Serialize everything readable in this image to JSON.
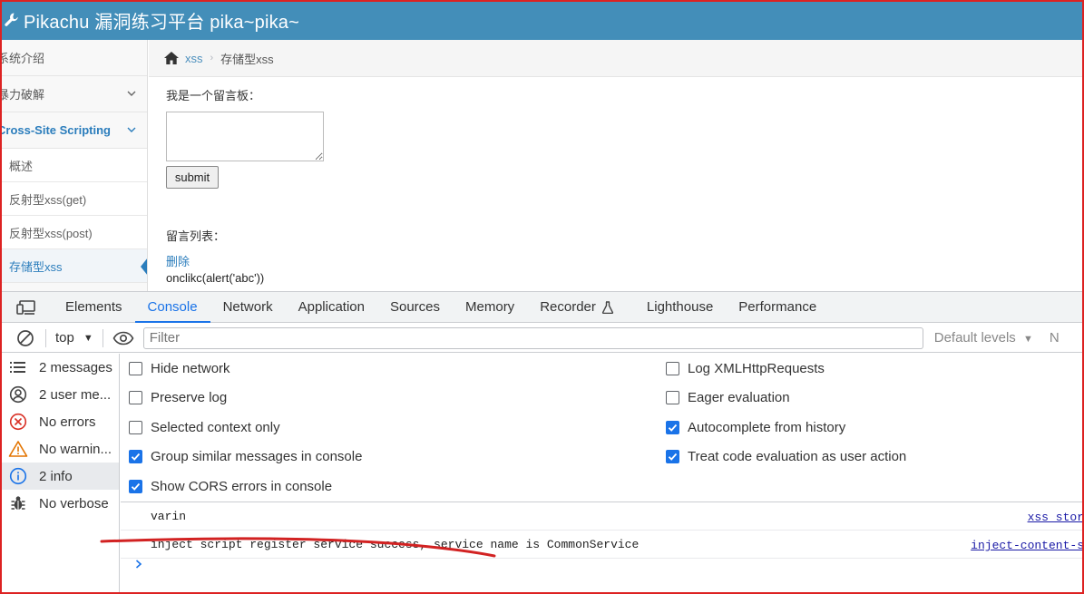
{
  "app": {
    "title": "Pikachu 漏洞练习平台 pika~pika~"
  },
  "sidebar": {
    "items": [
      {
        "label": "系统介绍"
      },
      {
        "label": "暴力破解"
      },
      {
        "label": "Cross-Site Scripting"
      }
    ],
    "subitems": [
      {
        "label": "概述"
      },
      {
        "label": "反射型xss(get)"
      },
      {
        "label": "反射型xss(post)"
      },
      {
        "label": "存储型xss"
      }
    ]
  },
  "breadcrumb": {
    "parent": "xss",
    "current": "存储型xss"
  },
  "content": {
    "board_label": "我是一个留言板：",
    "message_value": "",
    "submit_label": "submit",
    "list_label": "留言列表：",
    "delete_label": "删除",
    "message_text": "onclikc(alert('abc'))"
  },
  "devtools": {
    "tabs": [
      "Elements",
      "Console",
      "Network",
      "Application",
      "Sources",
      "Memory",
      "Recorder",
      "Lighthouse",
      "Performance"
    ],
    "active_tab": "Console",
    "toolbar": {
      "context": "top",
      "filter_placeholder": "Filter",
      "levels": "Default levels",
      "more": "N"
    },
    "sidebar": [
      {
        "label": "2 messages",
        "icon": "list-icon"
      },
      {
        "label": "2 user me...",
        "icon": "user-icon"
      },
      {
        "label": "No errors",
        "icon": "error-icon"
      },
      {
        "label": "No warnin...",
        "icon": "warning-icon"
      },
      {
        "label": "2 info",
        "icon": "info-icon"
      },
      {
        "label": "No verbose",
        "icon": "bug-icon"
      }
    ],
    "settings": [
      {
        "label": "Hide network",
        "checked": false
      },
      {
        "label": "Preserve log",
        "checked": false
      },
      {
        "label": "Selected context only",
        "checked": false
      },
      {
        "label": "Group similar messages in console",
        "checked": true
      },
      {
        "label": "Show CORS errors in console",
        "checked": true
      },
      {
        "label": "Log XMLHttpRequests",
        "checked": false
      },
      {
        "label": "Eager evaluation",
        "checked": false
      },
      {
        "label": "Autocomplete from history",
        "checked": true
      },
      {
        "label": "Treat code evaluation as user action",
        "checked": true
      }
    ],
    "messages": [
      {
        "text": "varin",
        "source": "xss_stor"
      },
      {
        "text": "inject script register service success, service name is CommonService",
        "source": "inject-content-s"
      }
    ]
  },
  "colors": {
    "header": "#438eb9",
    "link": "#2b7dbc",
    "devtools_accent": "#1a73e8",
    "annotation": "#d22222"
  }
}
